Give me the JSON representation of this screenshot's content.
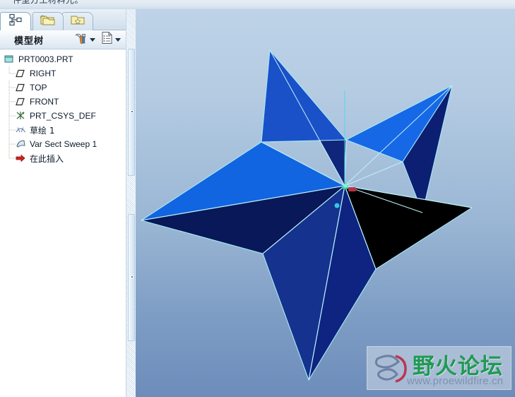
{
  "window": {
    "clipped_menu_text": "件型方工材料光。"
  },
  "tabs": [
    {
      "id": "model-tree",
      "icon": "model-tree-icon",
      "label": ""
    },
    {
      "id": "folders",
      "icon": "folder-browser-icon",
      "label": ""
    },
    {
      "id": "favorites",
      "icon": "favorites-folder-icon",
      "label": ""
    }
  ],
  "tree_panel": {
    "title": "模型树",
    "toolbar": [
      {
        "id": "settings",
        "icon": "tools-hammer-icon",
        "caret": true
      },
      {
        "id": "show",
        "icon": "list-sheet-icon",
        "caret": true
      }
    ],
    "nodes": [
      {
        "label": "PRT0003.PRT",
        "icon": "part-icon",
        "level": 0
      },
      {
        "label": "RIGHT",
        "icon": "datum-plane-icon",
        "level": 1
      },
      {
        "label": "TOP",
        "icon": "datum-plane-icon",
        "level": 1
      },
      {
        "label": "FRONT",
        "icon": "datum-plane-icon",
        "level": 1
      },
      {
        "label": "PRT_CSYS_DEF",
        "icon": "coord-system-icon",
        "level": 1
      },
      {
        "label": "草绘 1",
        "icon": "sketch-icon",
        "level": 1
      },
      {
        "label": "Var Sect Sweep 1",
        "icon": "sweep-icon",
        "level": 1
      },
      {
        "label": "在此插入",
        "icon": "insert-here-arrow-icon",
        "level": 1
      }
    ]
  },
  "viewport": {
    "model_name": "five-point-star-solid",
    "background_top": "#bed3e8",
    "background_bottom": "#6d8cba",
    "edge_color": "#a6e9f5",
    "face_colors": {
      "bright": "#1266e0",
      "mid": "#1a46c0",
      "dark": "#0b1d80",
      "darkest": "#071358",
      "deep": "#14307f"
    },
    "csys_marker": {
      "x_axis_color": "#c0324a",
      "y_axis_color": "#2de39a",
      "z_axis_color": "#35c6e8"
    }
  },
  "watermark": {
    "text_cjk": "野火论坛",
    "url": "www.proewildfire.cn",
    "text_color": "#1f9a52",
    "url_color": "#7d92ae"
  }
}
